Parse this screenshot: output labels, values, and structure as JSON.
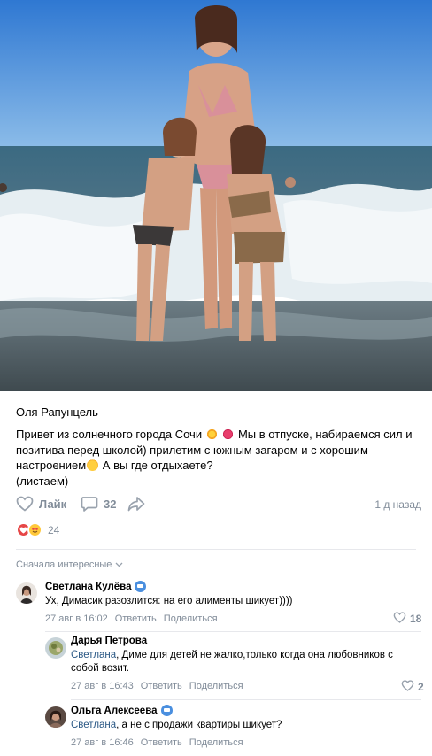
{
  "post": {
    "author": "Оля Рапунцель",
    "text_line1": "Привет из солнечного города Сочи",
    "text_line1b": "Мы в отпуске, набираемся сил и",
    "text_line2": "позитива перед школой) прилетим с южным загаром и с хорошим",
    "text_line3a": "настроением",
    "text_line3b": " А вы где отдыхаете?",
    "text_line4": "(листаем)",
    "emoji_icons": [
      "sun-emoji",
      "kiss-emoji",
      "smiling-face-with-hearts-emoji"
    ]
  },
  "actions": {
    "like_label": "Лайк",
    "comments_count": "32",
    "time": "1 д назад"
  },
  "reactions": {
    "count": "24",
    "colors": {
      "heart": "#e64646",
      "face": "#ffc83a"
    }
  },
  "comments_header": {
    "sort_label": "Сначала интересные"
  },
  "comments": [
    {
      "name": "Светлана Кулёва",
      "text": "Ух, Димасик разозлится: на его алименты шикует))))",
      "date": "27 авг в 16:02",
      "reply_label": "Ответить",
      "share_label": "Поделиться",
      "likes": "18"
    },
    {
      "name": "Дарья Петрова",
      "reply_to": "Светлана",
      "text": ", Диме для детей не жалко,только когда она любовников с собой возит.",
      "date": "27 авг в 16:43",
      "reply_label": "Ответить",
      "share_label": "Поделиться",
      "likes": "2"
    },
    {
      "name": "Ольга Алексеева",
      "reply_to": "Светлана",
      "text": ", а не с продажи квартиры шикует?",
      "date": "27 авг в 16:46",
      "reply_label": "Ответить",
      "share_label": "Поделиться"
    }
  ],
  "colors": {
    "accent_link": "#2a5885",
    "secondary_text": "#818c99",
    "divider": "#e7e8ec"
  }
}
